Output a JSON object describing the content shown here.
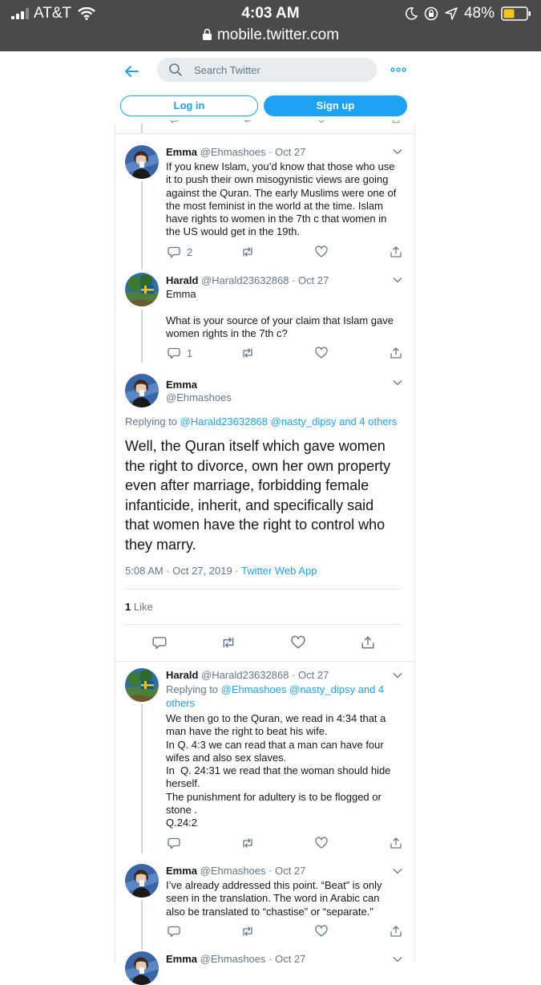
{
  "status": {
    "carrier": "AT&T",
    "time": "4:03 AM",
    "battery": "48%",
    "url": "mobile.twitter.com"
  },
  "header": {
    "search_placeholder": "Search Twitter",
    "login_label": "Log in",
    "signup_label": "Sign up"
  },
  "tweets": [
    {
      "name": "Emma",
      "handle": "@Ehmashoes",
      "date": "Oct 27",
      "text": "If you knew Islam, you’d know that those who use it to push their own misogynistic views are going against the Quran. The early Muslims were one of the most feminist in the world at the time. Islam have rights to women in the 7th c that women in the US would get in the 19th.",
      "reply_count": "2"
    },
    {
      "name": "Harald",
      "handle": "@Harald23632868",
      "date": "Oct 27",
      "text": "Emma\n\nWhat is your source of your claim that Islam gave women rights in the 7th c?",
      "reply_count": "1"
    }
  ],
  "focused": {
    "name": "Emma",
    "handle": "@Ehmashoes",
    "replying_label": "Replying to",
    "replying_users": "@Harald23632868 @nasty_dipsy",
    "replying_others": "and 4 others",
    "text": "Well, the Quran itself which gave women the right to divorce, own her own property even after marriage, forbidding female infanticide, inherit, and specifically said that women have the right to control who they marry.",
    "timestamp": "5:08 AM · Oct 27, 2019 · ",
    "source": "Twitter Web App",
    "like_count": "1",
    "like_label": "Like"
  },
  "replies": [
    {
      "name": "Harald",
      "handle": "@Harald23632868",
      "date": "Oct 27",
      "replying_label": "Replying to",
      "replying_users": "@Ehmashoes @nasty_dipsy",
      "replying_others_1": "and 4",
      "replying_others_2": "others",
      "text": "We then go to the Quran, we read in 4:34 that a man have the right to beat his wife.\nIn Q. 4:3 we can read that a man can have four wifes and also sex slaves.\nIn  Q. 24:31 we read that the woman should hide herself.\nThe punishment for adultery is to be flogged or stone .\nQ.24:2"
    },
    {
      "name": "Emma",
      "handle": "@Ehmashoes",
      "date": "Oct 27",
      "text": "I’ve already addressed this point. “Beat” is only seen in the translation. The word in Arabic can also be translated to “chastise” or “separate.”"
    },
    {
      "name": "Emma",
      "handle": "@Ehmashoes",
      "date": "Oct 27"
    }
  ],
  "icons": [
    "back-arrow-icon",
    "search-icon",
    "more-icon",
    "reply-icon",
    "retweet-icon",
    "like-icon",
    "share-icon",
    "caret-down-icon"
  ],
  "colors": {
    "accent": "#1da1f2",
    "muted": "#657786",
    "status_bar": "#4a4a4a",
    "battery": "#f5c518"
  }
}
